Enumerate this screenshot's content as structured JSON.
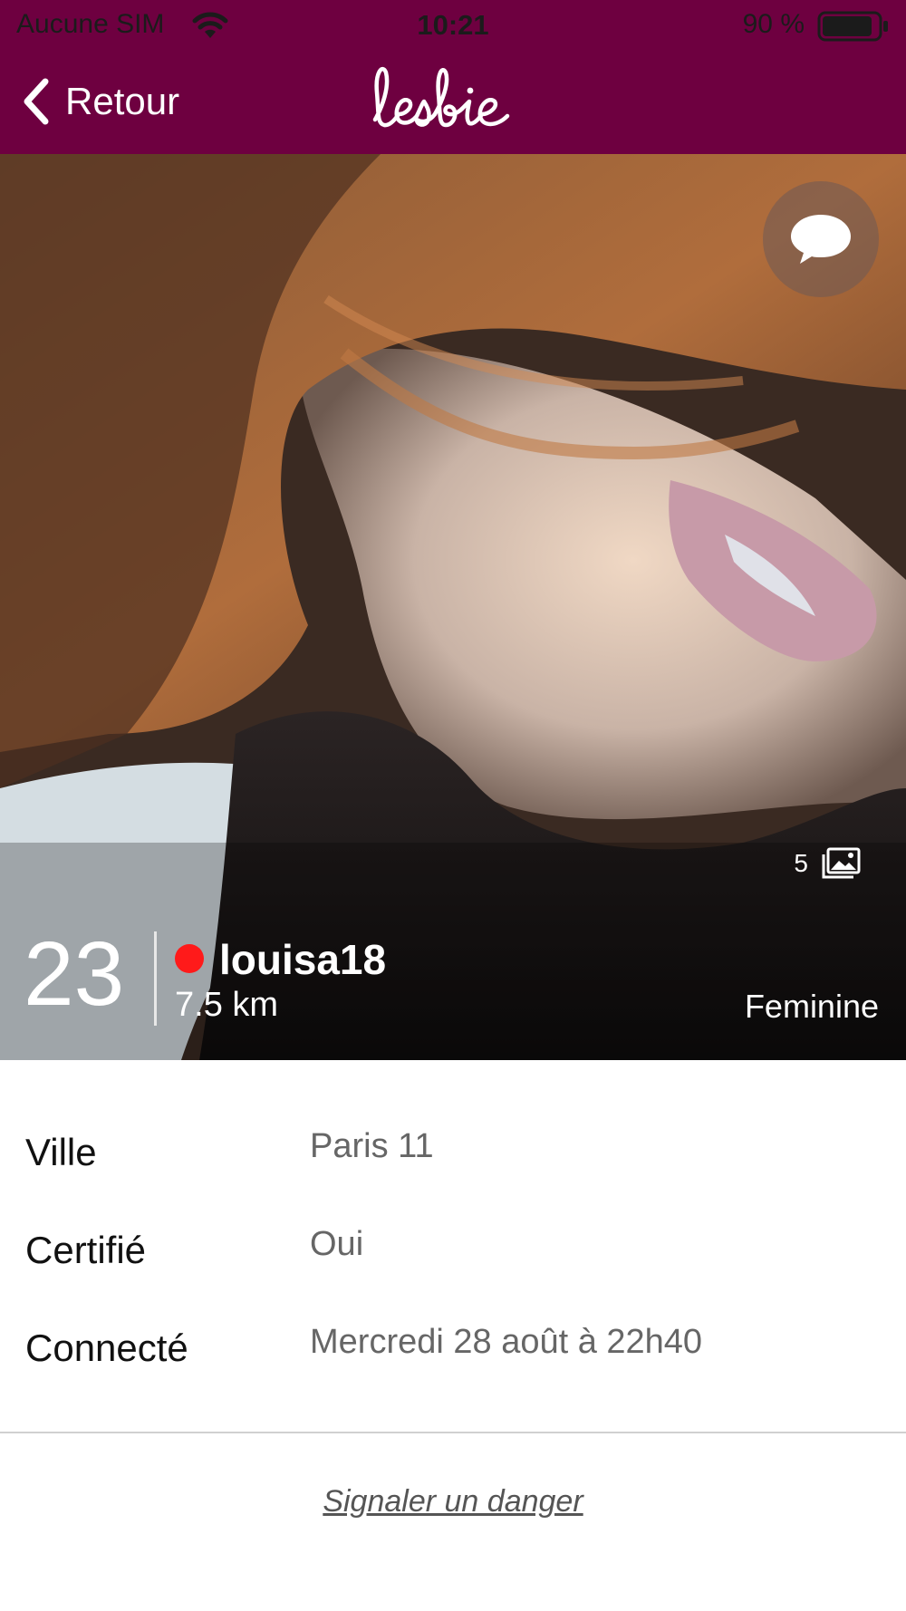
{
  "status_bar": {
    "carrier": "Aucune SIM",
    "time": "10:21",
    "battery": "90 %",
    "battery_level": 0.9,
    "icons": [
      "wifi-icon",
      "battery-icon"
    ]
  },
  "nav": {
    "back_label": "Retour",
    "back_icon": "chevron-left-icon",
    "logo_text": "lesbie",
    "background": "#6e0040"
  },
  "profile": {
    "chat_icon": "chat-bubble-icon",
    "photo_count": "5",
    "photo_count_icon": "gallery-icon",
    "age": "23",
    "online": true,
    "online_color": "#ff1a1a",
    "username": "louisa18",
    "distance": "7.5 km",
    "gender": "Feminine"
  },
  "details": [
    {
      "label": "Ville",
      "value": "Paris 11"
    },
    {
      "label": "Certifié",
      "value": "Oui"
    },
    {
      "label": "Connecté",
      "value": "Mercredi 28 août à 22h40"
    }
  ],
  "report_link": "Signaler un danger"
}
